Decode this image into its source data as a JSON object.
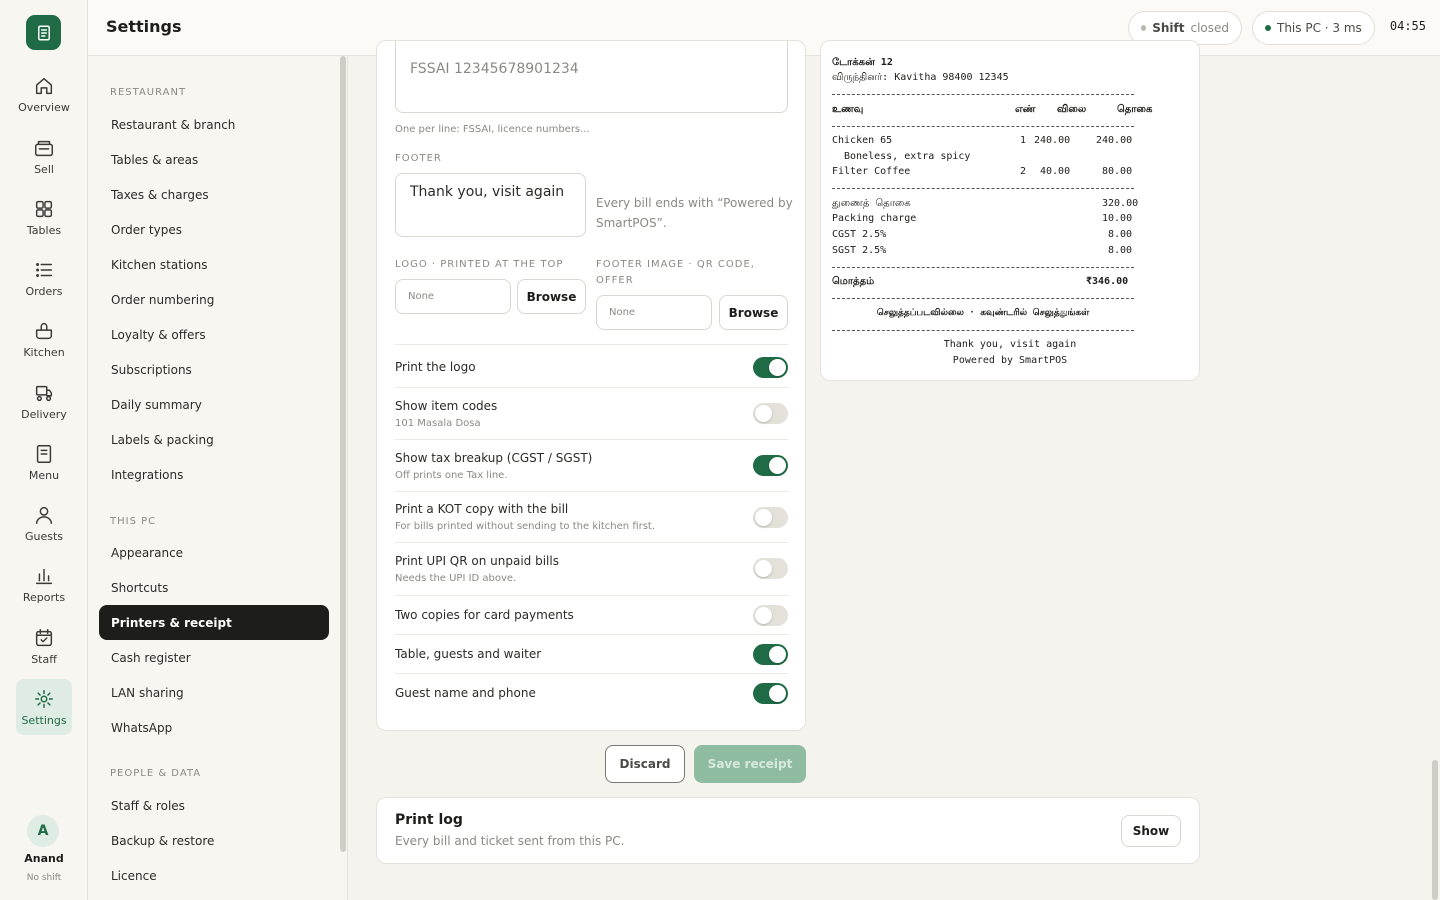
{
  "rail": {
    "items": [
      {
        "label": "Overview",
        "icon": "home-icon"
      },
      {
        "label": "Sell",
        "icon": "register-icon"
      },
      {
        "label": "Tables",
        "icon": "grid-icon"
      },
      {
        "label": "Orders",
        "icon": "list-icon"
      },
      {
        "label": "Kitchen",
        "icon": "pot-icon"
      },
      {
        "label": "Delivery",
        "icon": "scooter-icon"
      },
      {
        "label": "Menu",
        "icon": "document-icon"
      },
      {
        "label": "Guests",
        "icon": "person-icon"
      },
      {
        "label": "Reports",
        "icon": "bar-chart-icon"
      },
      {
        "label": "Staff",
        "icon": "calendar-icon"
      },
      {
        "label": "Settings",
        "icon": "gear-icon",
        "active": true
      }
    ],
    "user": {
      "initial": "A",
      "name": "Anand",
      "status": "No shift"
    }
  },
  "topbar": {
    "title": "Settings",
    "shift_label": "Shift",
    "shift_status": "closed",
    "pc_status": "This PC · 3 ms",
    "clock": "04:55"
  },
  "nav": {
    "sections": [
      {
        "title": "RESTAURANT",
        "items": [
          "Restaurant & branch",
          "Tables & areas",
          "Taxes & charges",
          "Order types",
          "Kitchen stations",
          "Order numbering",
          "Loyalty & offers",
          "Subscriptions",
          "Daily summary",
          "Labels & packing",
          "Integrations"
        ]
      },
      {
        "title": "THIS PC",
        "items": [
          "Appearance",
          "Shortcuts",
          "Printers & receipt",
          "Cash register",
          "LAN sharing",
          "WhatsApp"
        ]
      },
      {
        "title": "PEOPLE & DATA",
        "items": [
          "Staff & roles",
          "Backup & restore",
          "Licence"
        ]
      }
    ],
    "active": "Printers & receipt"
  },
  "receipt_form": {
    "header_lines_value": "FSSAI 12345678901234",
    "header_hint": "One per line: FSSAI, licence numbers...",
    "footer_label": "FOOTER",
    "footer_value": "Thank you, visit again",
    "footer_hint": "Every bill ends with “Powered by SmartPOS”.",
    "logo_label": "LOGO · PRINTED AT THE TOP",
    "logo_value": "None",
    "footer_image_label": "FOOTER IMAGE · QR CODE, OFFER",
    "footer_image_value": "None",
    "browse_label": "Browse",
    "toggles": [
      {
        "label": "Print the logo",
        "sub": "",
        "on": true
      },
      {
        "label": "Show item codes",
        "sub": "101 Masala Dosa",
        "on": false
      },
      {
        "label": "Show tax breakup (CGST / SGST)",
        "sub": "Off prints one Tax line.",
        "on": true
      },
      {
        "label": "Print a KOT copy with the bill",
        "sub": "For bills printed without sending to the kitchen first.",
        "on": false
      },
      {
        "label": "Print UPI QR on unpaid bills",
        "sub": "Needs the UPI ID above.",
        "on": false
      },
      {
        "label": "Two copies for card payments",
        "sub": "",
        "on": false
      },
      {
        "label": "Table, guests and waiter",
        "sub": "",
        "on": true
      },
      {
        "label": "Guest name and phone",
        "sub": "",
        "on": true
      }
    ],
    "discard_label": "Discard",
    "save_label": "Save receipt"
  },
  "receipt_preview": {
    "token": "டோக்கன் 12",
    "guest": "விருந்தினர்: Kavitha 98400 12345",
    "col_item": "உணவு",
    "col_qty": "எண்",
    "col_price": "விலை",
    "col_total": "தொகை",
    "items": [
      {
        "name": "Chicken 65",
        "qty": "1",
        "price": "240.00",
        "total": "240.00",
        "note": "Boneless, extra spicy"
      },
      {
        "name": "Filter Coffee",
        "qty": "2",
        "price": "40.00",
        "total": "80.00",
        "note": ""
      }
    ],
    "subtotal_label": "துணைத் தொகை",
    "subtotal": "320.00",
    "packing_label": "Packing charge",
    "packing": "10.00",
    "cgst_label": "CGST 2.5%",
    "cgst": "8.00",
    "sgst_label": "SGST 2.5%",
    "sgst": "8.00",
    "total_label": "மொத்தம்",
    "total": "₹346.00",
    "paid_note": "செலுத்தப்படவில்லை · கவுண்டரில் செலுத்துங்கள்",
    "footer1": "Thank you, visit again",
    "footer2": "Powered by SmartPOS"
  },
  "print_log": {
    "title": "Print log",
    "subtitle": "Every bill and ticket sent from this PC.",
    "button": "Show"
  }
}
